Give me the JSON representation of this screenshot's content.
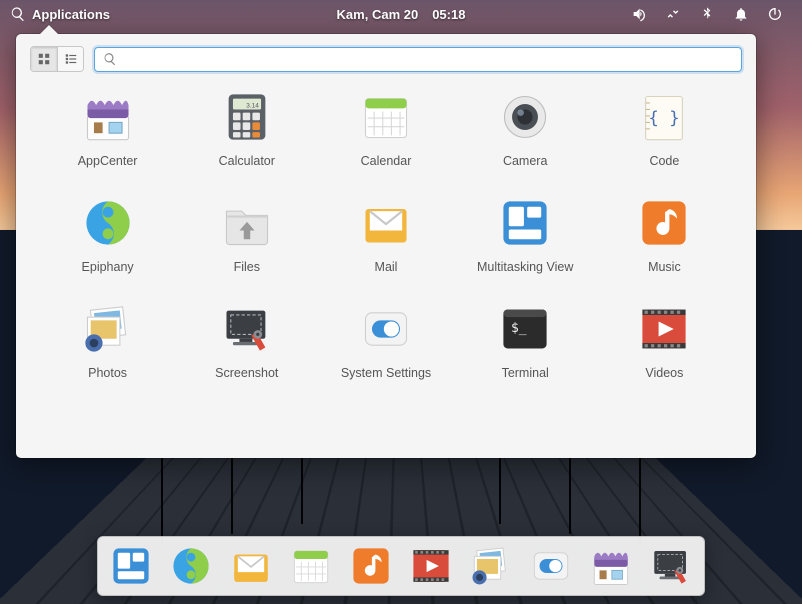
{
  "topbar": {
    "applications_label": "Applications",
    "date": "Kam, Cam 20",
    "time": "05:18"
  },
  "search": {
    "value": "",
    "placeholder": ""
  },
  "apps": [
    {
      "id": "appcenter",
      "label": "AppCenter"
    },
    {
      "id": "calculator",
      "label": "Calculator"
    },
    {
      "id": "calendar",
      "label": "Calendar"
    },
    {
      "id": "camera",
      "label": "Camera"
    },
    {
      "id": "code",
      "label": "Code"
    },
    {
      "id": "epiphany",
      "label": "Epiphany"
    },
    {
      "id": "files",
      "label": "Files"
    },
    {
      "id": "mail",
      "label": "Mail"
    },
    {
      "id": "multitasking",
      "label": "Multitasking View"
    },
    {
      "id": "music",
      "label": "Music"
    },
    {
      "id": "photos",
      "label": "Photos"
    },
    {
      "id": "screenshot",
      "label": "Screenshot"
    },
    {
      "id": "settings",
      "label": "System Settings"
    },
    {
      "id": "terminal",
      "label": "Terminal"
    },
    {
      "id": "videos",
      "label": "Videos"
    }
  ],
  "dock": [
    "multitasking",
    "epiphany",
    "mail",
    "calendar",
    "music",
    "videos",
    "photos",
    "settings",
    "appcenter",
    "screenshot"
  ]
}
